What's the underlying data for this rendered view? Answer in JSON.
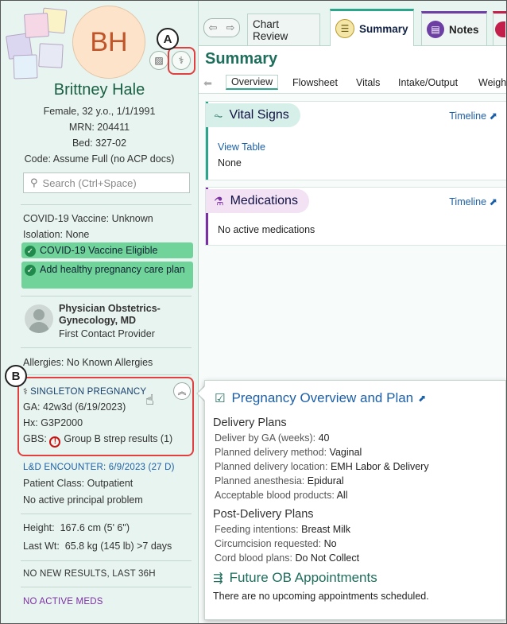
{
  "patient": {
    "initials": "BH",
    "name": "Brittney Hale",
    "demographics": "Female, 32 y.o., 1/1/1991",
    "mrn": "MRN: 204411",
    "bed": "Bed: 327-02",
    "code": "Code: Assume Full (no ACP docs)"
  },
  "callouts": {
    "a": "A",
    "b": "B"
  },
  "search": {
    "placeholder": "Search (Ctrl+Space)"
  },
  "sidebar": {
    "covid_vaccine": "COVID-19 Vaccine: Unknown",
    "isolation": "Isolation: None",
    "pill_vaccine": "COVID-19 Vaccine Eligible",
    "pill_pregnancy": "Add healthy pregnancy care plan",
    "provider_name": "Physician Obstetrics-Gynecology, MD",
    "provider_role": "First Contact Provider",
    "allergies": "Allergies: No Known Allergies",
    "pregnancy_header": "SINGLETON PREGNANCY",
    "ga": "GA: 42w3d (6/19/2023)",
    "hx": "Hx: G3P2000",
    "gbs_label": "GBS:",
    "gbs_value": "Group B strep results (1)",
    "encounter": "L&D ENCOUNTER: 6/9/2023 (27 D)",
    "patient_class": "Patient Class: Outpatient",
    "principal_problem": "No active principal problem",
    "height_label": "Height:",
    "height_value": "167.6 cm (5' 6\")",
    "weight_label": "Last Wt:",
    "weight_value": "65.8 kg (145 lb) >7 days",
    "no_results": "NO NEW RESULTS, LAST 36H",
    "no_meds": "NO ACTIVE MEDS"
  },
  "tabs": {
    "chart_review": "Chart Review",
    "summary": "Summary",
    "notes": "Notes"
  },
  "summary": {
    "title": "Summary",
    "subtabs": [
      "Overview",
      "Flowsheet",
      "Vitals",
      "Intake/Output",
      "Weigh"
    ]
  },
  "vitals_card": {
    "title": "Vital Signs",
    "timeline": "Timeline",
    "view_table": "View Table",
    "value": "None"
  },
  "meds_card": {
    "title": "Medications",
    "timeline": "Timeline",
    "value": "No active medications"
  },
  "popup": {
    "title": "Pregnancy Overview and Plan",
    "delivery_heading": "Delivery Plans",
    "delivery_rows": [
      {
        "label": "Deliver by GA (weeks):",
        "value": "40"
      },
      {
        "label": "Planned delivery method:",
        "value": "Vaginal"
      },
      {
        "label": "Planned delivery location:",
        "value": "EMH Labor & Delivery"
      },
      {
        "label": "Planned anesthesia:",
        "value": "Epidural"
      },
      {
        "label": "Acceptable blood products:",
        "value": "All"
      }
    ],
    "post_heading": "Post-Delivery Plans",
    "post_rows": [
      {
        "label": "Feeding intentions:",
        "value": "Breast Milk"
      },
      {
        "label": "Circumcision requested:",
        "value": "No"
      },
      {
        "label": "Cord blood plans:",
        "value": "Do Not Collect"
      }
    ],
    "appointments_heading": "Future OB Appointments",
    "appointments_text": "There are no upcoming appointments scheduled."
  },
  "colors": {
    "sidebar_bg": "#e8f4ef",
    "accent_teal": "#2ba58c",
    "pill_green": "#6fd39a",
    "highlight_red": "#e0403f",
    "link_blue": "#1b5fa8",
    "meds_purple": "#7a2fa3"
  },
  "icons": {
    "photo": "patient-photo-collage",
    "header_a": "pregnancy-stethoscope-icon",
    "search": "search-icon",
    "check": "check-circle-icon",
    "alert": "alert-icon",
    "collapse": "chevron-double-up-icon",
    "vitals": "pulse-icon",
    "meds": "mortar-pestle-icon",
    "pregnancy_plan": "checklist-icon",
    "appointments": "calendar-arrow-icon"
  }
}
